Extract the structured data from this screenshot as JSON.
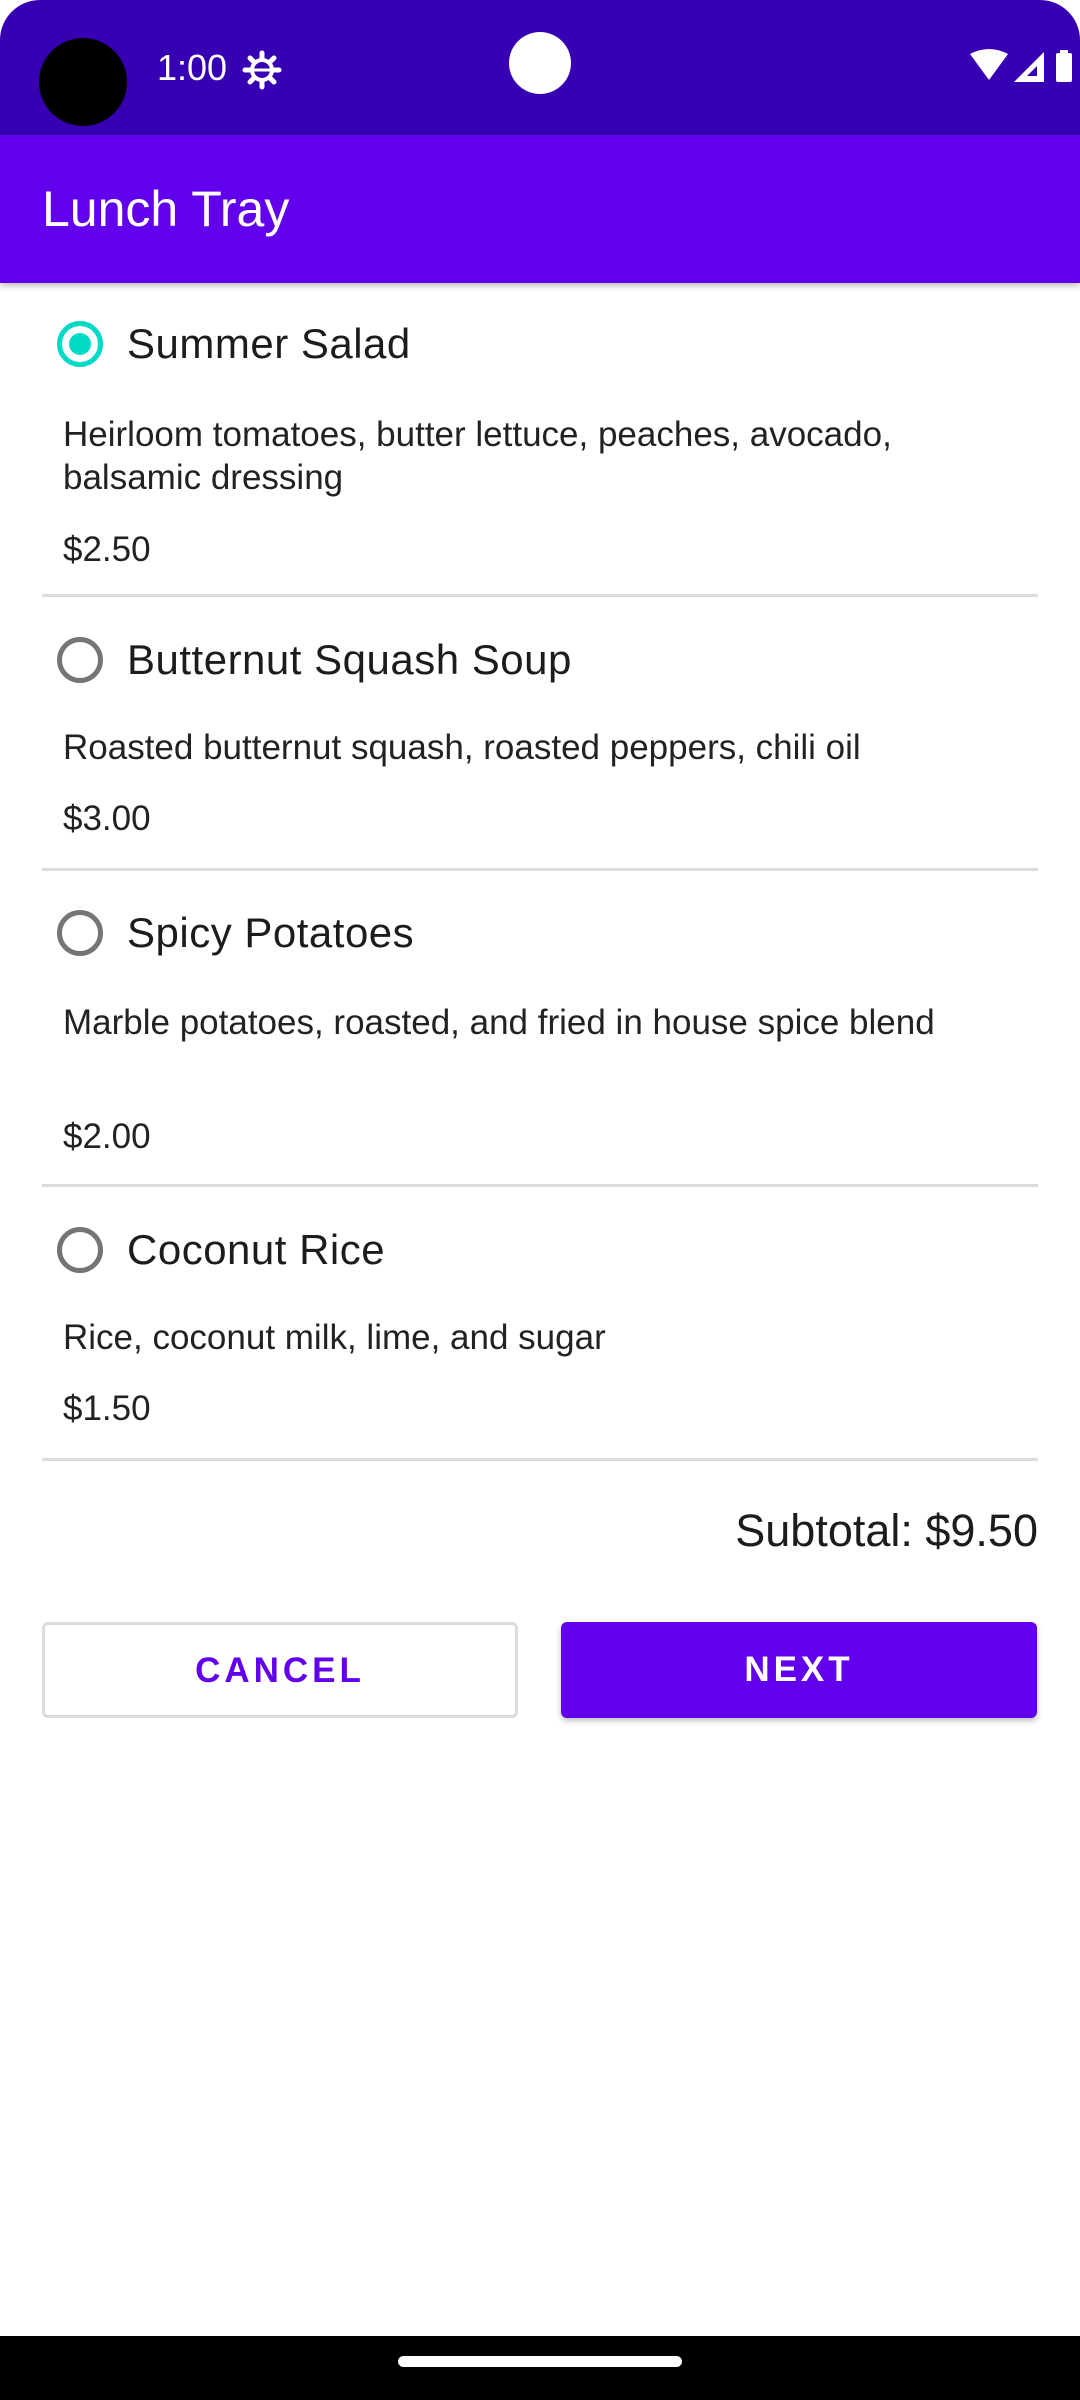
{
  "status_bar": {
    "time": "1:00"
  },
  "app_bar": {
    "title": "Lunch Tray"
  },
  "menu": {
    "items": [
      {
        "name": "Summer Salad",
        "description": "Heirloom tomatoes, butter lettuce, peaches, avocado, balsamic dressing",
        "price": "$2.50",
        "selected": true
      },
      {
        "name": "Butternut Squash Soup",
        "description": "Roasted butternut squash, roasted peppers, chili oil",
        "price": "$3.00",
        "selected": false
      },
      {
        "name": "Spicy Potatoes",
        "description": "Marble potatoes, roasted, and fried in house spice blend",
        "price": "$2.00",
        "selected": false
      },
      {
        "name": "Coconut Rice",
        "description": "Rice, coconut milk, lime, and sugar",
        "price": "$1.50",
        "selected": false
      }
    ]
  },
  "subtotal": "Subtotal: $9.50",
  "actions": {
    "cancel_label": "CANCEL",
    "next_label": "NEXT"
  },
  "colors": {
    "primary": "#6200ee",
    "primary_dark": "#3700b3",
    "accent": "#03dac5"
  },
  "icons": {
    "settings": "gear-icon",
    "wifi": "wifi-icon",
    "signal": "cell-signal-icon",
    "battery": "battery-icon"
  }
}
